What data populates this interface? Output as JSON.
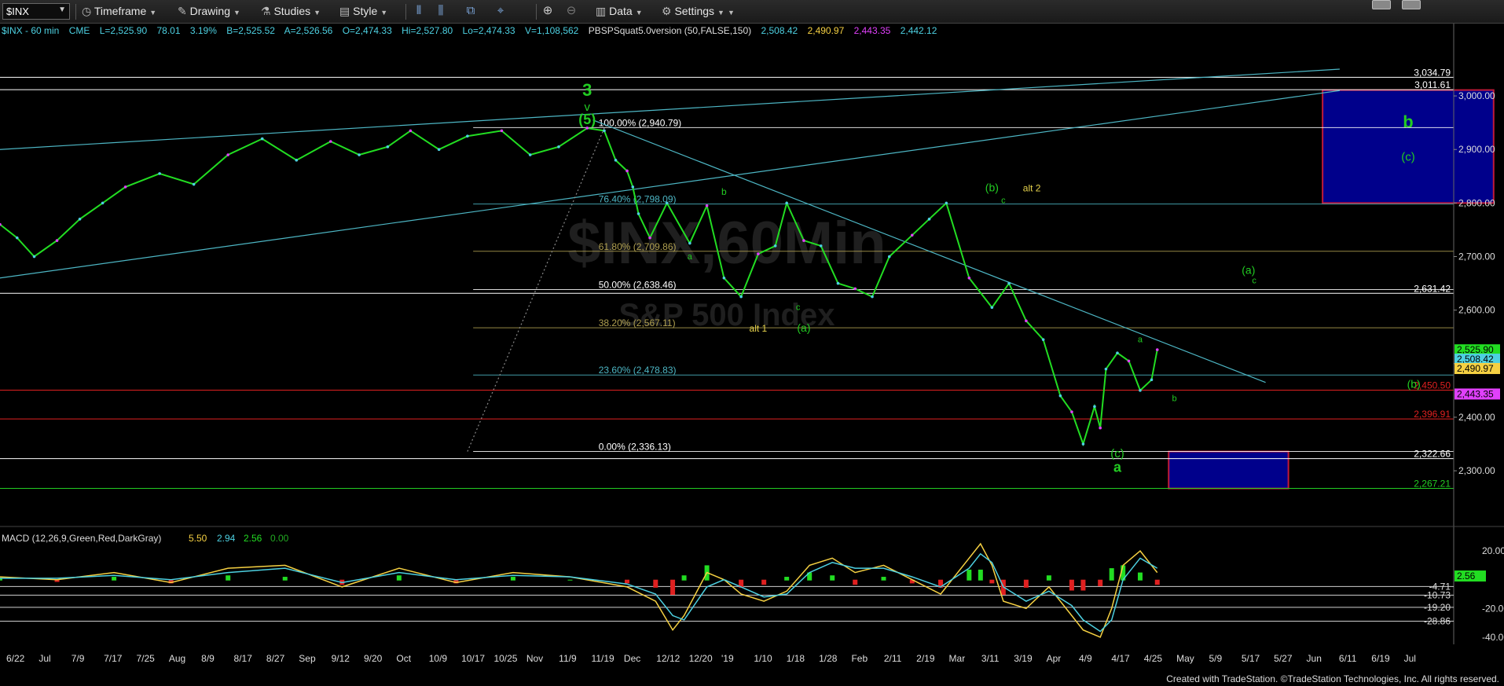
{
  "toolbar": {
    "symbol": "$INX",
    "timeframe_label": "Timeframe",
    "drawing_label": "Drawing",
    "studies_label": "Studies",
    "style_label": "Style",
    "data_label": "Data",
    "settings_label": "Settings"
  },
  "info_line": {
    "symbol_tf": "$INX - 60 min",
    "exchange": "CME",
    "last": "L=2,525.90",
    "change": "78.01",
    "change_pct": "3.19%",
    "bid": "B=2,525.52",
    "ask": "A=2,526.56",
    "open": "O=2,474.33",
    "high": "Hi=2,527.80",
    "low": "Lo=2,474.33",
    "volume": "V=1,108,562",
    "study": "PBSPSquat5.0version (50,FALSE,150)",
    "study_values": [
      "2,508.42",
      "2,490.97",
      "2,443.35",
      "2,442.12"
    ],
    "study_colors": [
      "#4dd0e1",
      "#f5d042",
      "#e040fb",
      "#4dd0e1"
    ]
  },
  "watermark": {
    "line1": "$INX,60Min",
    "line2": "S&P 500 Index"
  },
  "footer": "Created with TradeStation. ©TradeStation Technologies, Inc. All rights reserved.",
  "colors": {
    "background": "#000000",
    "price": "#22dd22",
    "wave_label": "#22cc22",
    "alt_label": "#e8d44d",
    "fib_text": "#9a9a9a",
    "trend_line": "#4db6c4",
    "support": "#e02020",
    "target_box": "#00008b"
  },
  "chart_data": {
    "type": "line",
    "title": "$INX - 60 min",
    "ylim": [
      2240,
      3050
    ],
    "y_ticks": [
      "3,000.00",
      "2,900.00",
      "2,800.00",
      "2,700.00",
      "2,600.00",
      "2,500.00",
      "2,400.00",
      "2,300.00"
    ],
    "x_labels": [
      "6/22",
      "Jul",
      "7/9",
      "7/17",
      "7/25",
      "Aug",
      "8/9",
      "8/17",
      "8/27",
      "Sep",
      "9/12",
      "9/20",
      "Oct",
      "10/9",
      "10/17",
      "10/25",
      "Nov",
      "11/9",
      "11/19",
      "Dec",
      "12/12",
      "12/20",
      "'19",
      "1/10",
      "1/18",
      "1/28",
      "Feb",
      "2/11",
      "2/19",
      "Mar",
      "3/11",
      "3/19",
      "Apr",
      "4/9",
      "4/17",
      "4/25",
      "May",
      "5/9",
      "5/17",
      "5/27",
      "Jun",
      "6/11",
      "6/19",
      "Jul"
    ],
    "series": [
      {
        "x": [
          0,
          3,
          6,
          10,
          14,
          18,
          22,
          28,
          34,
          40,
          46,
          52,
          58,
          63,
          68,
          72,
          77,
          82,
          88,
          93,
          98,
          103,
          106,
          108,
          110,
          111,
          112,
          114,
          117,
          121,
          124,
          127,
          130,
          133,
          136,
          138,
          141,
          144,
          147,
          150,
          153,
          156,
          160,
          163,
          166,
          170,
          174,
          177,
          180,
          183,
          186,
          188,
          190,
          192,
          193,
          194,
          196,
          198,
          200,
          202,
          203
        ],
        "values": [
          2760,
          2735,
          2700,
          2730,
          2770,
          2800,
          2830,
          2855,
          2835,
          2890,
          2920,
          2880,
          2915,
          2890,
          2905,
          2935,
          2900,
          2925,
          2935,
          2890,
          2905,
          2940,
          2935,
          2880,
          2860,
          2830,
          2780,
          2735,
          2800,
          2725,
          2795,
          2660,
          2625,
          2705,
          2720,
          2800,
          2730,
          2720,
          2650,
          2640,
          2625,
          2700,
          2740,
          2770,
          2800,
          2660,
          2605,
          2650,
          2580,
          2545,
          2440,
          2410,
          2350,
          2420,
          2380,
          2490,
          2520,
          2505,
          2450,
          2470,
          2526
        ]
      }
    ],
    "horizontal_levels": [
      {
        "label": "3,034.79",
        "value": 3034.79,
        "color": "#ffffff"
      },
      {
        "label": "3,011.61",
        "value": 3011.61,
        "color": "#ffffff"
      },
      {
        "label": "2,631.42",
        "value": 2631.42,
        "color": "#ffffff"
      },
      {
        "label": "2,450.50",
        "value": 2450.5,
        "color": "#e02020"
      },
      {
        "label": "2,396.91",
        "value": 2396.91,
        "color": "#e02020"
      },
      {
        "label": "2,322.66",
        "value": 2322.66,
        "color": "#ffffff"
      },
      {
        "label": "2,267.21",
        "value": 2267.21,
        "color": "#22cc22"
      }
    ],
    "fib_levels": [
      {
        "label": "100.00% (2,940.79)",
        "value": 2940.79,
        "color": "#ffffff"
      },
      {
        "label": "76.40% (2,798.09)",
        "value": 2798.09,
        "color": "#4db6c4"
      },
      {
        "label": "61.80% (2,709.86)",
        "value": 2709.86,
        "color": "#b0a050"
      },
      {
        "label": "50.00% (2,638.46)",
        "value": 2638.46,
        "color": "#ffffff"
      },
      {
        "label": "38.20% (2,567.11)",
        "value": 2567.11,
        "color": "#b0a050"
      },
      {
        "label": "23.60% (2,478.83)",
        "value": 2478.83,
        "color": "#4db6c4"
      },
      {
        "label": "0.00% (2,336.13)",
        "value": 2336.13,
        "color": "#ffffff"
      }
    ],
    "price_tags": [
      {
        "label": "2,525.90",
        "value": 2525.9,
        "bg": "#22dd22",
        "fg": "#000000"
      },
      {
        "label": "2,508.42",
        "value": 2508.42,
        "bg": "#4dd0e1",
        "fg": "#000000"
      },
      {
        "label": "2,490.97",
        "value": 2490.97,
        "bg": "#f5d042",
        "fg": "#000000"
      },
      {
        "label": "2,443.35",
        "value": 2443.35,
        "bg": "#e040fb",
        "fg": "#000000"
      }
    ],
    "target_zones": [
      {
        "x0": 232,
        "x1": 262,
        "y0": 2800,
        "y1": 3011,
        "labels": [
          "b",
          "(c)"
        ]
      },
      {
        "x0": 205,
        "x1": 226,
        "y0": 2267,
        "y1": 2336,
        "labels": []
      }
    ],
    "trend_lines": [
      {
        "x": [
          0,
          235
        ],
        "values": [
          2900,
          3050
        ]
      },
      {
        "x": [
          0,
          235
        ],
        "values": [
          2660,
          3010
        ]
      },
      {
        "x": [
          104,
          222
        ],
        "values": [
          2955,
          2465
        ]
      },
      {
        "x": [
          82,
          106
        ],
        "values": [
          2336,
          2940
        ]
      }
    ],
    "wave_labels": [
      {
        "text": "3",
        "x": 103,
        "value": 3000,
        "size": 22,
        "color": "#22cc22"
      },
      {
        "text": "v",
        "x": 103,
        "value": 2972,
        "size": 15,
        "color": "#22cc22"
      },
      {
        "text": "(5)",
        "x": 103,
        "value": 2947,
        "size": 18,
        "color": "#22cc22"
      },
      {
        "text": "b",
        "x": 127,
        "value": 2815,
        "size": 12,
        "color": "#22cc22"
      },
      {
        "text": "a",
        "x": 121,
        "value": 2695,
        "size": 11,
        "color": "#22cc22"
      },
      {
        "text": "c",
        "x": 140,
        "value": 2600,
        "size": 11,
        "color": "#22cc22"
      },
      {
        "text": "alt 1",
        "x": 133,
        "value": 2560,
        "size": 12,
        "color": "#e8d44d"
      },
      {
        "text": "(a)",
        "x": 141,
        "value": 2560,
        "size": 14,
        "color": "#22cc22"
      },
      {
        "text": "(b)",
        "x": 174,
        "value": 2822,
        "size": 14,
        "color": "#22cc22"
      },
      {
        "text": "alt 2",
        "x": 181,
        "value": 2822,
        "size": 12,
        "color": "#e8d44d"
      },
      {
        "text": "c",
        "x": 176,
        "value": 2800,
        "size": 11,
        "color": "#22cc22"
      },
      {
        "text": "a",
        "x": 200,
        "value": 2540,
        "size": 11,
        "color": "#22cc22"
      },
      {
        "text": "b",
        "x": 206,
        "value": 2430,
        "size": 11,
        "color": "#22cc22"
      },
      {
        "text": "(c)",
        "x": 196,
        "value": 2325,
        "size": 15,
        "color": "#22cc22"
      },
      {
        "text": "a",
        "x": 196,
        "value": 2298,
        "size": 18,
        "color": "#22cc22"
      },
      {
        "text": "(a)",
        "x": 219,
        "value": 2668,
        "size": 14,
        "color": "#22cc22"
      },
      {
        "text": "c",
        "x": 220,
        "value": 2650,
        "size": 11,
        "color": "#22cc22"
      },
      {
        "text": "(b)",
        "x": 248,
        "value": 2455,
        "size": 14,
        "color": "#22cc22"
      }
    ],
    "macd": {
      "title": "MACD (12,26,9,Green,Red,DarkGray)",
      "values": [
        "5.50",
        "2.94",
        "2.56",
        "0.00"
      ],
      "value_colors": [
        "#f5d042",
        "#4dd0e1",
        "#22dd22",
        "#22aa22"
      ],
      "ylim": [
        -45,
        25
      ],
      "y_ticks": [
        "20.00",
        "-20.00",
        "-40.00"
      ],
      "levels": [
        "-4.71",
        "-10.73",
        "-19.20",
        "-28.86"
      ],
      "current_tag": "2.56",
      "x": [
        0,
        10,
        20,
        30,
        40,
        50,
        60,
        70,
        80,
        90,
        100,
        110,
        115,
        118,
        120,
        124,
        127,
        130,
        134,
        138,
        142,
        146,
        150,
        155,
        160,
        165,
        170,
        172,
        174,
        176,
        180,
        184,
        188,
        190,
        193,
        195,
        197,
        200,
        203
      ],
      "line": [
        2,
        0,
        5,
        -2,
        8,
        10,
        -5,
        8,
        -2,
        5,
        2,
        -5,
        -15,
        -35,
        -25,
        5,
        0,
        -10,
        -15,
        -8,
        10,
        15,
        5,
        10,
        0,
        -10,
        15,
        25,
        10,
        -15,
        -20,
        -5,
        -25,
        -35,
        -40,
        -20,
        10,
        20,
        5
      ],
      "signal": [
        1,
        1,
        3,
        0,
        5,
        8,
        -2,
        5,
        0,
        3,
        2,
        -3,
        -10,
        -25,
        -28,
        -5,
        0,
        -5,
        -12,
        -10,
        5,
        12,
        8,
        8,
        2,
        -5,
        8,
        18,
        12,
        -5,
        -15,
        -8,
        -18,
        -28,
        -36,
        -28,
        0,
        15,
        8
      ]
    }
  }
}
